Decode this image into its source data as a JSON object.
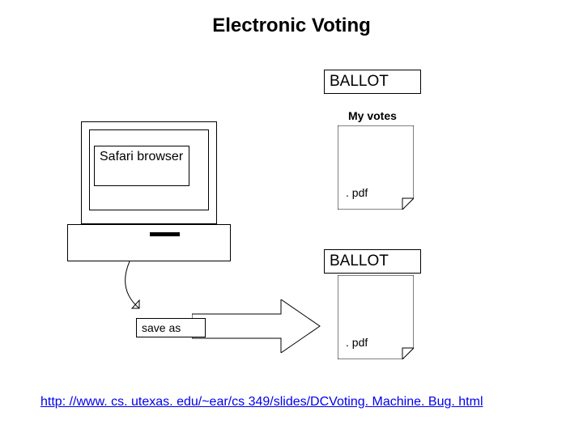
{
  "title": "Electronic Voting",
  "ballot_label_1": "BALLOT",
  "my_votes_label": "My votes",
  "safari_label": "Safari browser",
  "doc1_ext": ". pdf",
  "ballot_label_2": "BALLOT",
  "save_as_label": "save as",
  "doc2_ext": ". pdf",
  "link_text": "http: //www. cs. utexas. edu/~ear/cs 349/slides/DCVoting. Machine. Bug. html"
}
